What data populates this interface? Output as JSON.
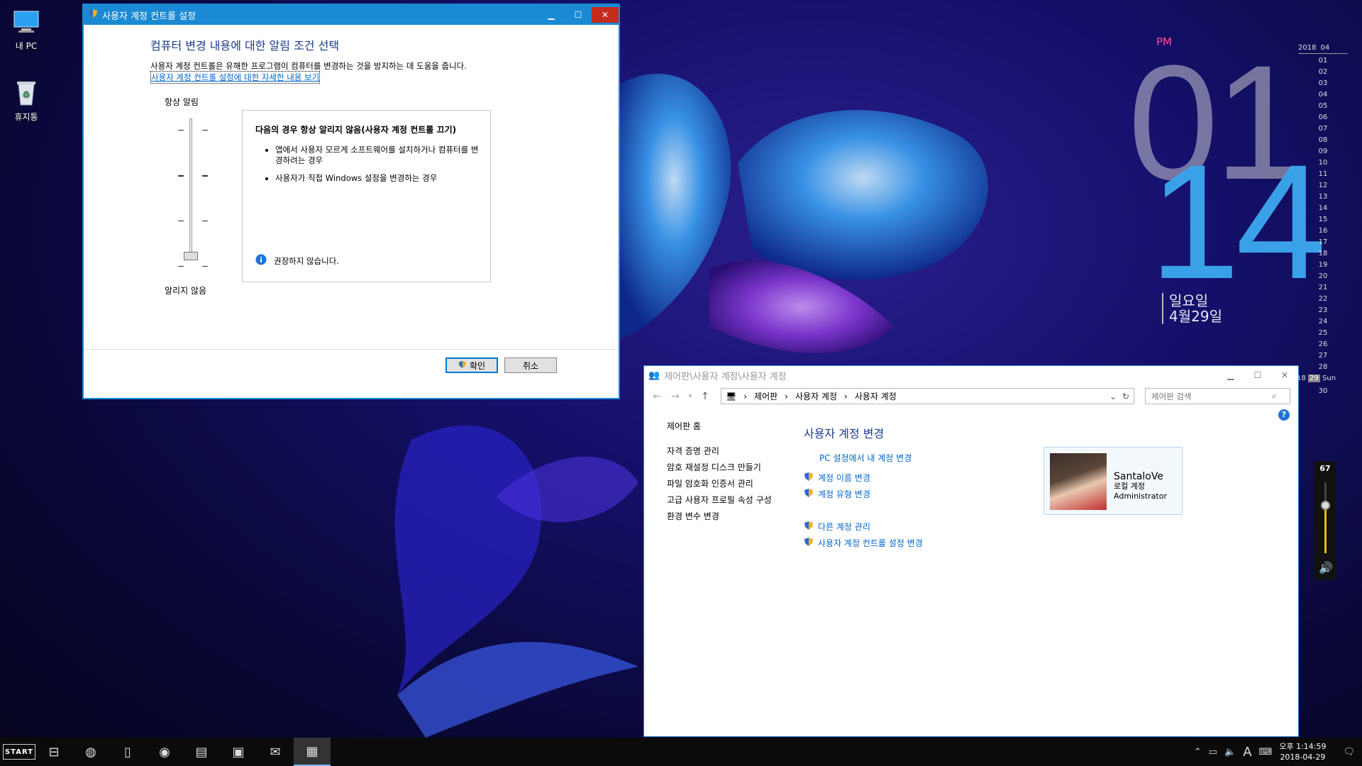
{
  "desktop": {
    "icons": [
      {
        "label": "내 PC",
        "icon": "computer-icon"
      },
      {
        "label": "휴지통",
        "icon": "recycle-bin-icon"
      }
    ]
  },
  "clock_widget": {
    "ampm": "PM",
    "hour": "01",
    "minute": "14",
    "weekday": "일요일",
    "date": "4월29일"
  },
  "calendar": {
    "year": "2018",
    "month": "04",
    "days": [
      "01",
      "02",
      "03",
      "04",
      "05",
      "06",
      "07",
      "08",
      "09",
      "10",
      "11",
      "12",
      "13",
      "14",
      "15",
      "16",
      "17",
      "18",
      "19",
      "20",
      "21",
      "22",
      "23",
      "24",
      "25",
      "26",
      "27",
      "28"
    ],
    "week": "w18",
    "today": "29",
    "today_dow": "Sun",
    "last": "30"
  },
  "volume_widget": {
    "level": "67",
    "level_value": 0.67
  },
  "uac": {
    "title": "사용자 계정 컨트롤 설정",
    "heading": "컴퓨터 변경 내용에 대한 알림 조건 선택",
    "description": "사용자 계정 컨트롤은 유해한 프로그램이 컴퓨터를 변경하는 것을 방지하는 데 도움을 줍니다.",
    "link": "사용자 계정 컨트롤 설정에 대한 자세한 내용 보기",
    "always_notify": "항상 알림",
    "never_notify": "알리지 않음",
    "slider_level": 0,
    "panel_title": "다음의 경우 항상 알리지 않음(사용자 계정 컨트롤 끄기)",
    "bullets": [
      "앱에서 사용자 모르게 소프트웨어를 설치하거나 컴퓨터를 변경하려는 경우",
      "사용자가 직접 Windows 설정을 변경하는 경우"
    ],
    "warning": "권장하지 않습니다.",
    "ok_label": "확인",
    "cancel_label": "취소"
  },
  "control_panel": {
    "title": "제어판\\사용자 계정\\사용자 계정",
    "breadcrumb": [
      "제어판",
      "사용자 계정",
      "사용자 계정"
    ],
    "search_placeholder": "제어판 검색",
    "sidebar": {
      "home": "제어판 홈",
      "items": [
        "자격 증명 관리",
        "암호 재설정 디스크 만들기",
        "파일 암호화 인증서 관리",
        "고급 사용자 프로필 속성 구성",
        "환경 변수 변경"
      ]
    },
    "main_title": "사용자 계정 변경",
    "links_top": "PC 설정에서 내 계정 변경",
    "links_group1": [
      "계정 이름 변경",
      "계정 유형 변경"
    ],
    "links_group2": [
      "다른 계정 관리",
      "사용자 계정 컨트롤 설정 변경"
    ],
    "user": {
      "name": "SantaloVe",
      "type": "로컬 계정",
      "role": "Administrator"
    }
  },
  "taskbar": {
    "start": "START",
    "tray_clock_time": "오후 1:14:59",
    "tray_clock_date": "2018-04-29",
    "ime": "A"
  },
  "colors": {
    "accent": "#1a8ad4",
    "link": "#0066cc",
    "clock_minute": "#3aa0e8",
    "pm": "#ff4fa0"
  }
}
